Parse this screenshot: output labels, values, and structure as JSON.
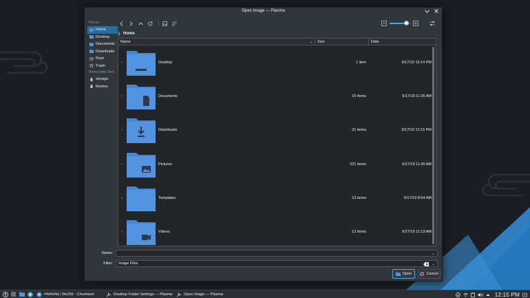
{
  "window": {
    "title": "Open Image — Plasma",
    "minimize_icon": "chevron-down-icon",
    "close_icon": "close-icon"
  },
  "sidebar": {
    "places_header": "Places",
    "removable_header": "Removable Devi",
    "places": [
      {
        "label": "Home",
        "icon": "home-folder-icon",
        "active": true
      },
      {
        "label": "Desktop",
        "icon": "desktop-folder-icon",
        "active": false
      },
      {
        "label": "Documents",
        "icon": "documents-folder-icon",
        "active": false
      },
      {
        "label": "Downloads",
        "icon": "downloads-folder-icon",
        "active": false
      },
      {
        "label": "Root",
        "icon": "root-icon",
        "active": false
      },
      {
        "label": "Trash",
        "icon": "trash-icon",
        "active": false
      }
    ],
    "removable": [
      {
        "label": "storage",
        "icon": "usb-drive-icon"
      },
      {
        "label": "themes",
        "icon": "usb-drive-icon"
      }
    ]
  },
  "toolbar": {
    "buttons": [
      "back-icon",
      "forward-icon",
      "up-icon",
      "reload-icon",
      "preview-icon",
      "sort-icon"
    ],
    "zoom_level": 0.8
  },
  "breadcrumb": {
    "current": "Home"
  },
  "list": {
    "headers": {
      "name": "Name",
      "size": "Size",
      "date": "Date"
    },
    "rows": [
      {
        "name": "Desktop",
        "size": "1 item",
        "date": "6/17/19 12:14 PM",
        "emblem": "desktop"
      },
      {
        "name": "Documents",
        "size": "15 items",
        "date": "6/17/19 11:35 AM",
        "emblem": "document"
      },
      {
        "name": "Downloads",
        "size": "21 items",
        "date": "6/17/19 12:15 PM",
        "emblem": "download"
      },
      {
        "name": "Pictures",
        "size": "221 items",
        "date": "6/17/19 11:35 AM",
        "emblem": "picture"
      },
      {
        "name": "Templates",
        "size": "13 items",
        "date": "6/17/19 8:54 AM",
        "emblem": "none"
      },
      {
        "name": "Videos",
        "size": "12 items",
        "date": "6/17/19 11:13 AM",
        "emblem": "video"
      }
    ]
  },
  "fields": {
    "name_label": "Name:",
    "name_value": "",
    "filter_label": "Filter:",
    "filter_value": "Image Files"
  },
  "buttons": {
    "open": "Open",
    "cancel": "Cancel"
  },
  "taskbar": {
    "tasks": [
      {
        "label": "#4d4d4d | 0to255 - Chromium",
        "active": false
      },
      {
        "label": "Desktop Folder Settings — Plasma",
        "active": false
      },
      {
        "label": "Open Image — Plasma",
        "active": true
      }
    ],
    "clock": "12:15 PM"
  },
  "colors": {
    "accent": "#3daee9",
    "folder": "#5294e2",
    "folder_dark": "#4a86cc"
  }
}
